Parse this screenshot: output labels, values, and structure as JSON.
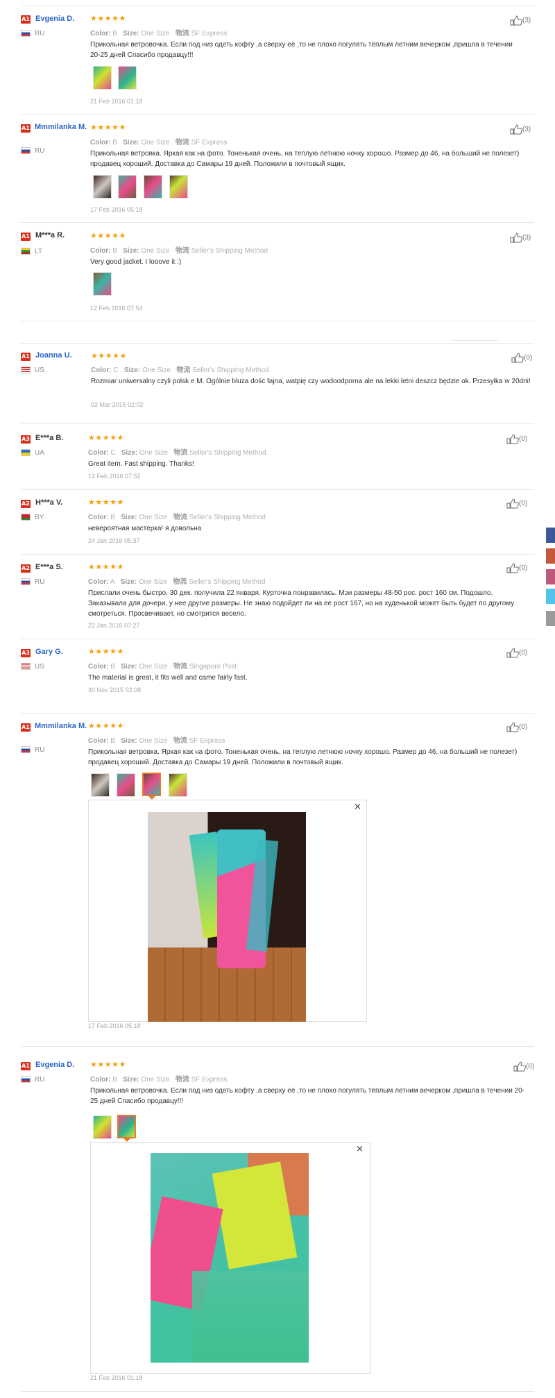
{
  "labels": {
    "color": "Color:",
    "size": "Size:",
    "logistics": "物流"
  },
  "reviews": [
    {
      "badge": "A1",
      "name": "Evgenia D.",
      "country": "RU",
      "color": "B",
      "size": "One Size",
      "shipping": "SF Express",
      "text": "Прикольная ветровочка. Если под низ одеть кофту ,а сверху её ,то не плохо погулять тёплым летним вечерком ,пришла в течении 20-25 дней Спасибо продавцу!!!",
      "date": "21 Feb 2016 01:18",
      "likes": "(3)"
    },
    {
      "badge": "A1",
      "name": "Mmmilanka M.",
      "country": "RU",
      "color": "B",
      "size": "One Size",
      "shipping": "SF Express",
      "text": "Прикольная ветровка. Яркая как на фото. Тоненькая очень, на теплую летнюю ночку хорошо. Размер до 46, на больший не полезет) продавец хороший. Доставка до Самары 19 дней. Положили в почтовый ящик.",
      "date": "17 Feb 2016 05:18",
      "likes": "(3)"
    },
    {
      "badge": "A1",
      "name": "M***a R.",
      "country": "LT",
      "color": "B",
      "size": "One Size",
      "shipping": "Seller's Shipping Method",
      "text": "Very good jacket. I looove it :)",
      "date": "12 Feb 2016 07:54",
      "likes": "(3)"
    },
    {
      "badge": "A1",
      "name": "Joanna U.",
      "country": "US",
      "color": "C",
      "size": "One Size",
      "shipping": "Seller's Shipping Method",
      "text": "Rozmiar uniwersalny czyli polsk e M. Ogólnie bluza dość fajna, watpię czy wodoodporna ale na lekki letni deszcz będzie ok. Przesyłka w 20dni!",
      "date": "02 Mar 2016 02:02",
      "likes": "(0)"
    },
    {
      "badge": "A3",
      "name": "E***a B.",
      "country": "UA",
      "color": "C",
      "size": "One Size",
      "shipping": "Seller's Shipping Method",
      "text": "Great item. Fast shipping. Thanks!",
      "date": "12 Feb 2016 07:52",
      "likes": "(0)"
    },
    {
      "badge": "A2",
      "name": "H***a V.",
      "country": "BY",
      "color": "B",
      "size": "One Size",
      "shipping": "Seller's Shipping Method",
      "text": "невероятная мастерка! я довольна",
      "date": "24 Jan 2016 05:37",
      "likes": "(0)"
    },
    {
      "badge": "A2",
      "name": "E***a S.",
      "country": "RU",
      "color": "A",
      "size": "One Size",
      "shipping": "Seller's Shipping Method",
      "text": "Прислали очень быстро. 30 дек. получила 22 января. Курточка понравилась. Мэи размеры 48-50 рос. рост 160 см. Подошло. Заказывала для дочери, у нее другие размеры. Не знаю подойдет ли на ее рост 167, но на худенькой может быть будет по другому смотреться. Просвечивает, но смотрится весело.",
      "date": "22 Jan 2016 07:27",
      "likes": "(0)"
    },
    {
      "badge": "A3",
      "name": "Gary G.",
      "country": "US",
      "color": "B",
      "size": "One Size",
      "shipping": "Singapore Post",
      "text": "The material is great, it fits well and came fairly fast.",
      "date": "30 Nov 2015 02:08",
      "likes": "(0)"
    },
    {
      "badge": "A1",
      "name": "Mmmilanka M.",
      "country": "RU",
      "color": "B",
      "size": "One Size",
      "shipping": "SF Express",
      "text": "Прикольная ветровка. Яркая как на фото. Тоненькая очень, на теплую летнюю ночку хорошо. Размер до 46, на больший не полезет) продавец хороший. Доставка до Самары 19 дней. Положили в почтовый ящик.",
      "date": "17 Feb 2016 05:18",
      "likes": "(0)"
    },
    {
      "badge": "A1",
      "name": "Evgenia D.",
      "country": "RU",
      "color": "B",
      "size": "One Size",
      "shipping": "SF Express",
      "text": "Прикольная ветровочка. Если под низ одеть кофту ,а сверху её ,то не плохо погулять тёплым летним вечерком ,пришла в течении 20-25 дней Спасибо продавцу!!!",
      "date": "21 Feb 2016 01:18",
      "likes": "(0)"
    }
  ],
  "stars": "★★★★★",
  "close": "×",
  "colors": {
    "name": "#2a66c9",
    "badge": "#d9301e",
    "star": "#f59e0b",
    "selected": "#e97b2e"
  }
}
